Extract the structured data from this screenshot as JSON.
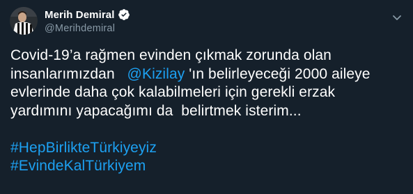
{
  "tweet": {
    "author": {
      "name": "Merih Demiral",
      "handle": "@Merihdemiral",
      "verified_icon": "verified-badge-icon",
      "avatar_icon": "profile-avatar"
    },
    "more_icon": "chevron-down-icon",
    "text": {
      "line1": "Covid-19’a rağmen evinden çıkmak zorunda olan",
      "line2_before": "insanlarımızdan   ",
      "mention": "@Kizilay",
      "line2_after": " 'ın belirleyeceği 2000 aileye",
      "line3": "evlerinde daha çok kalabilmeleri için gerekli erzak",
      "line4": "yardımını yapacağımı da  belirtmek isterim..."
    },
    "hashtags": [
      "#HepBirlikteTürkiyeyiz",
      "#EvindeKalTürkiyem"
    ]
  },
  "colors": {
    "background": "#15202b",
    "text": "#ffffff",
    "secondary": "#8899a6",
    "link": "#1da1f2"
  }
}
